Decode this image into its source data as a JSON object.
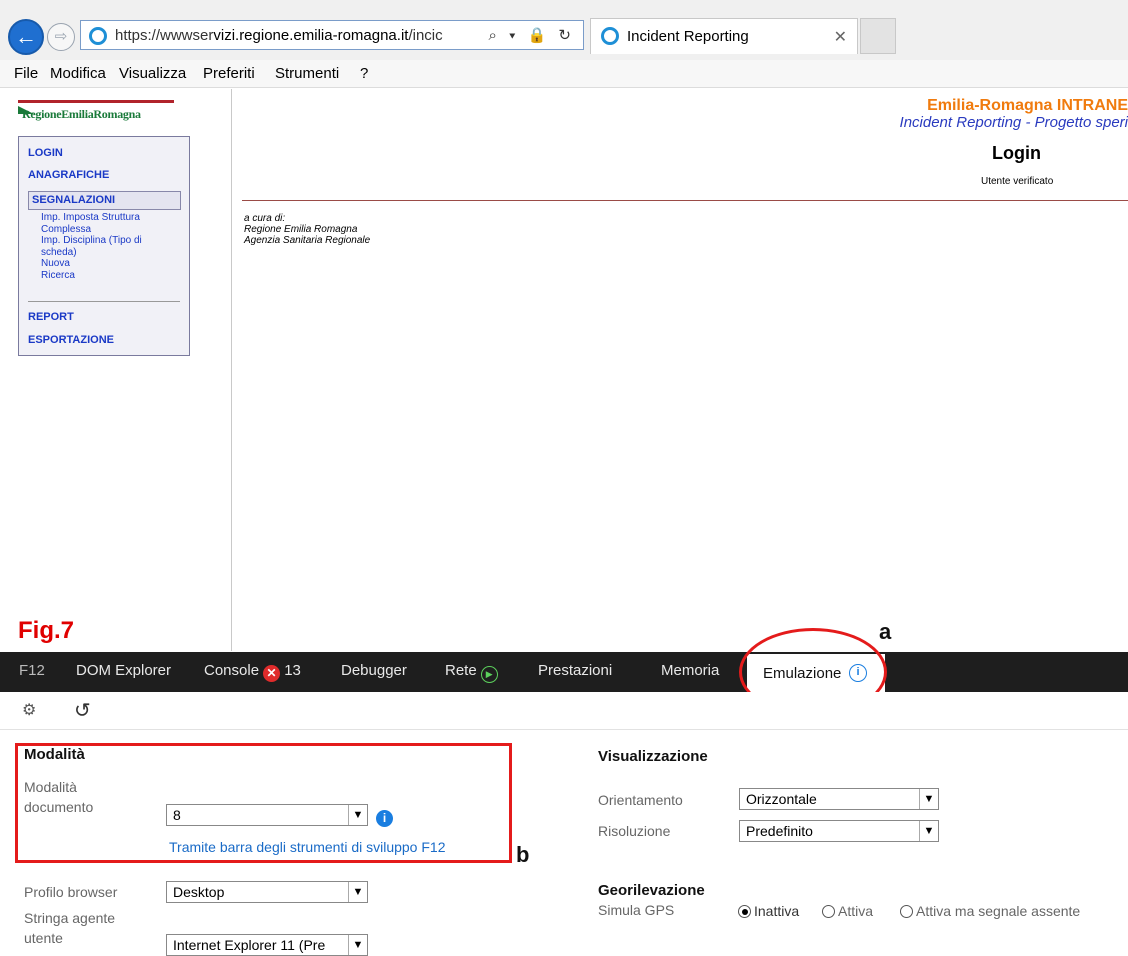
{
  "browser": {
    "url_prefix": "https://wwwser",
    "url_domain": "vizi.regione.emilia-romagna.it",
    "url_suffix": "/incic",
    "address_controls": "⌕ ▾ 🔒 ↻",
    "tab_title": "Incident Reporting",
    "tab_close": "✕"
  },
  "menu": [
    "File",
    "Modifica",
    "Visualizza",
    "Preferiti",
    "Strumenti",
    "?"
  ],
  "page": {
    "logo_text": "RegioneEmiliaRomagna",
    "left_nav": {
      "login": "LOGIN",
      "anagrafiche": "ANAGRAFICHE",
      "segnalazioni": "SEGNALAZIONI",
      "sub": [
        "Imp. Imposta Struttura",
        "Complessa",
        "Imp. Disciplina (Tipo di",
        "scheda)",
        "Nuova",
        "Ricerca"
      ],
      "report": "REPORT",
      "esportazione": "ESPORTAZIONE"
    },
    "header_title": "Emilia-Romagna INTRANE",
    "header_subtitle": "Incident Reporting - Progetto speri",
    "login_title": "Login",
    "verified_text": "Utente verificato",
    "credits": [
      "a cura di:",
      "Regione Emilia Romagna",
      "Agenzia Sanitaria Regionale"
    ],
    "fig_label": "Fig.7",
    "annotation_a": "a"
  },
  "devtools": {
    "tabs": {
      "f12": "F12",
      "dom": "DOM Explorer",
      "console": "Console",
      "console_errors": "13",
      "debugger": "Debugger",
      "rete": "Rete",
      "prestazioni": "Prestazioni",
      "memoria": "Memoria",
      "emulazione": "Emulazione"
    },
    "modalita": {
      "title": "Modalità",
      "doc_label_1": "Modalità",
      "doc_label_2": "documento",
      "doc_value": "8",
      "f12_link": "Tramite barra degli strumenti di sviluppo F12",
      "annotation_b": "b"
    },
    "profilo_label": "Profilo browser",
    "profilo_value": "Desktop",
    "ua_label_1": "Stringa agente",
    "ua_label_2": "utente",
    "ua_value": "Internet Explorer 11 (Pre",
    "visualizzazione": {
      "title": "Visualizzazione",
      "orient_label": "Orientamento",
      "orient_value": "Orizzontale",
      "res_label": "Risoluzione",
      "res_value": "Predefinito"
    },
    "georilevazione": {
      "title": "Georilevazione",
      "gps_label": "Simula GPS",
      "options": [
        "Inattiva",
        "Attiva",
        "Attiva ma segnale assente"
      ],
      "selected_index": 0
    }
  }
}
